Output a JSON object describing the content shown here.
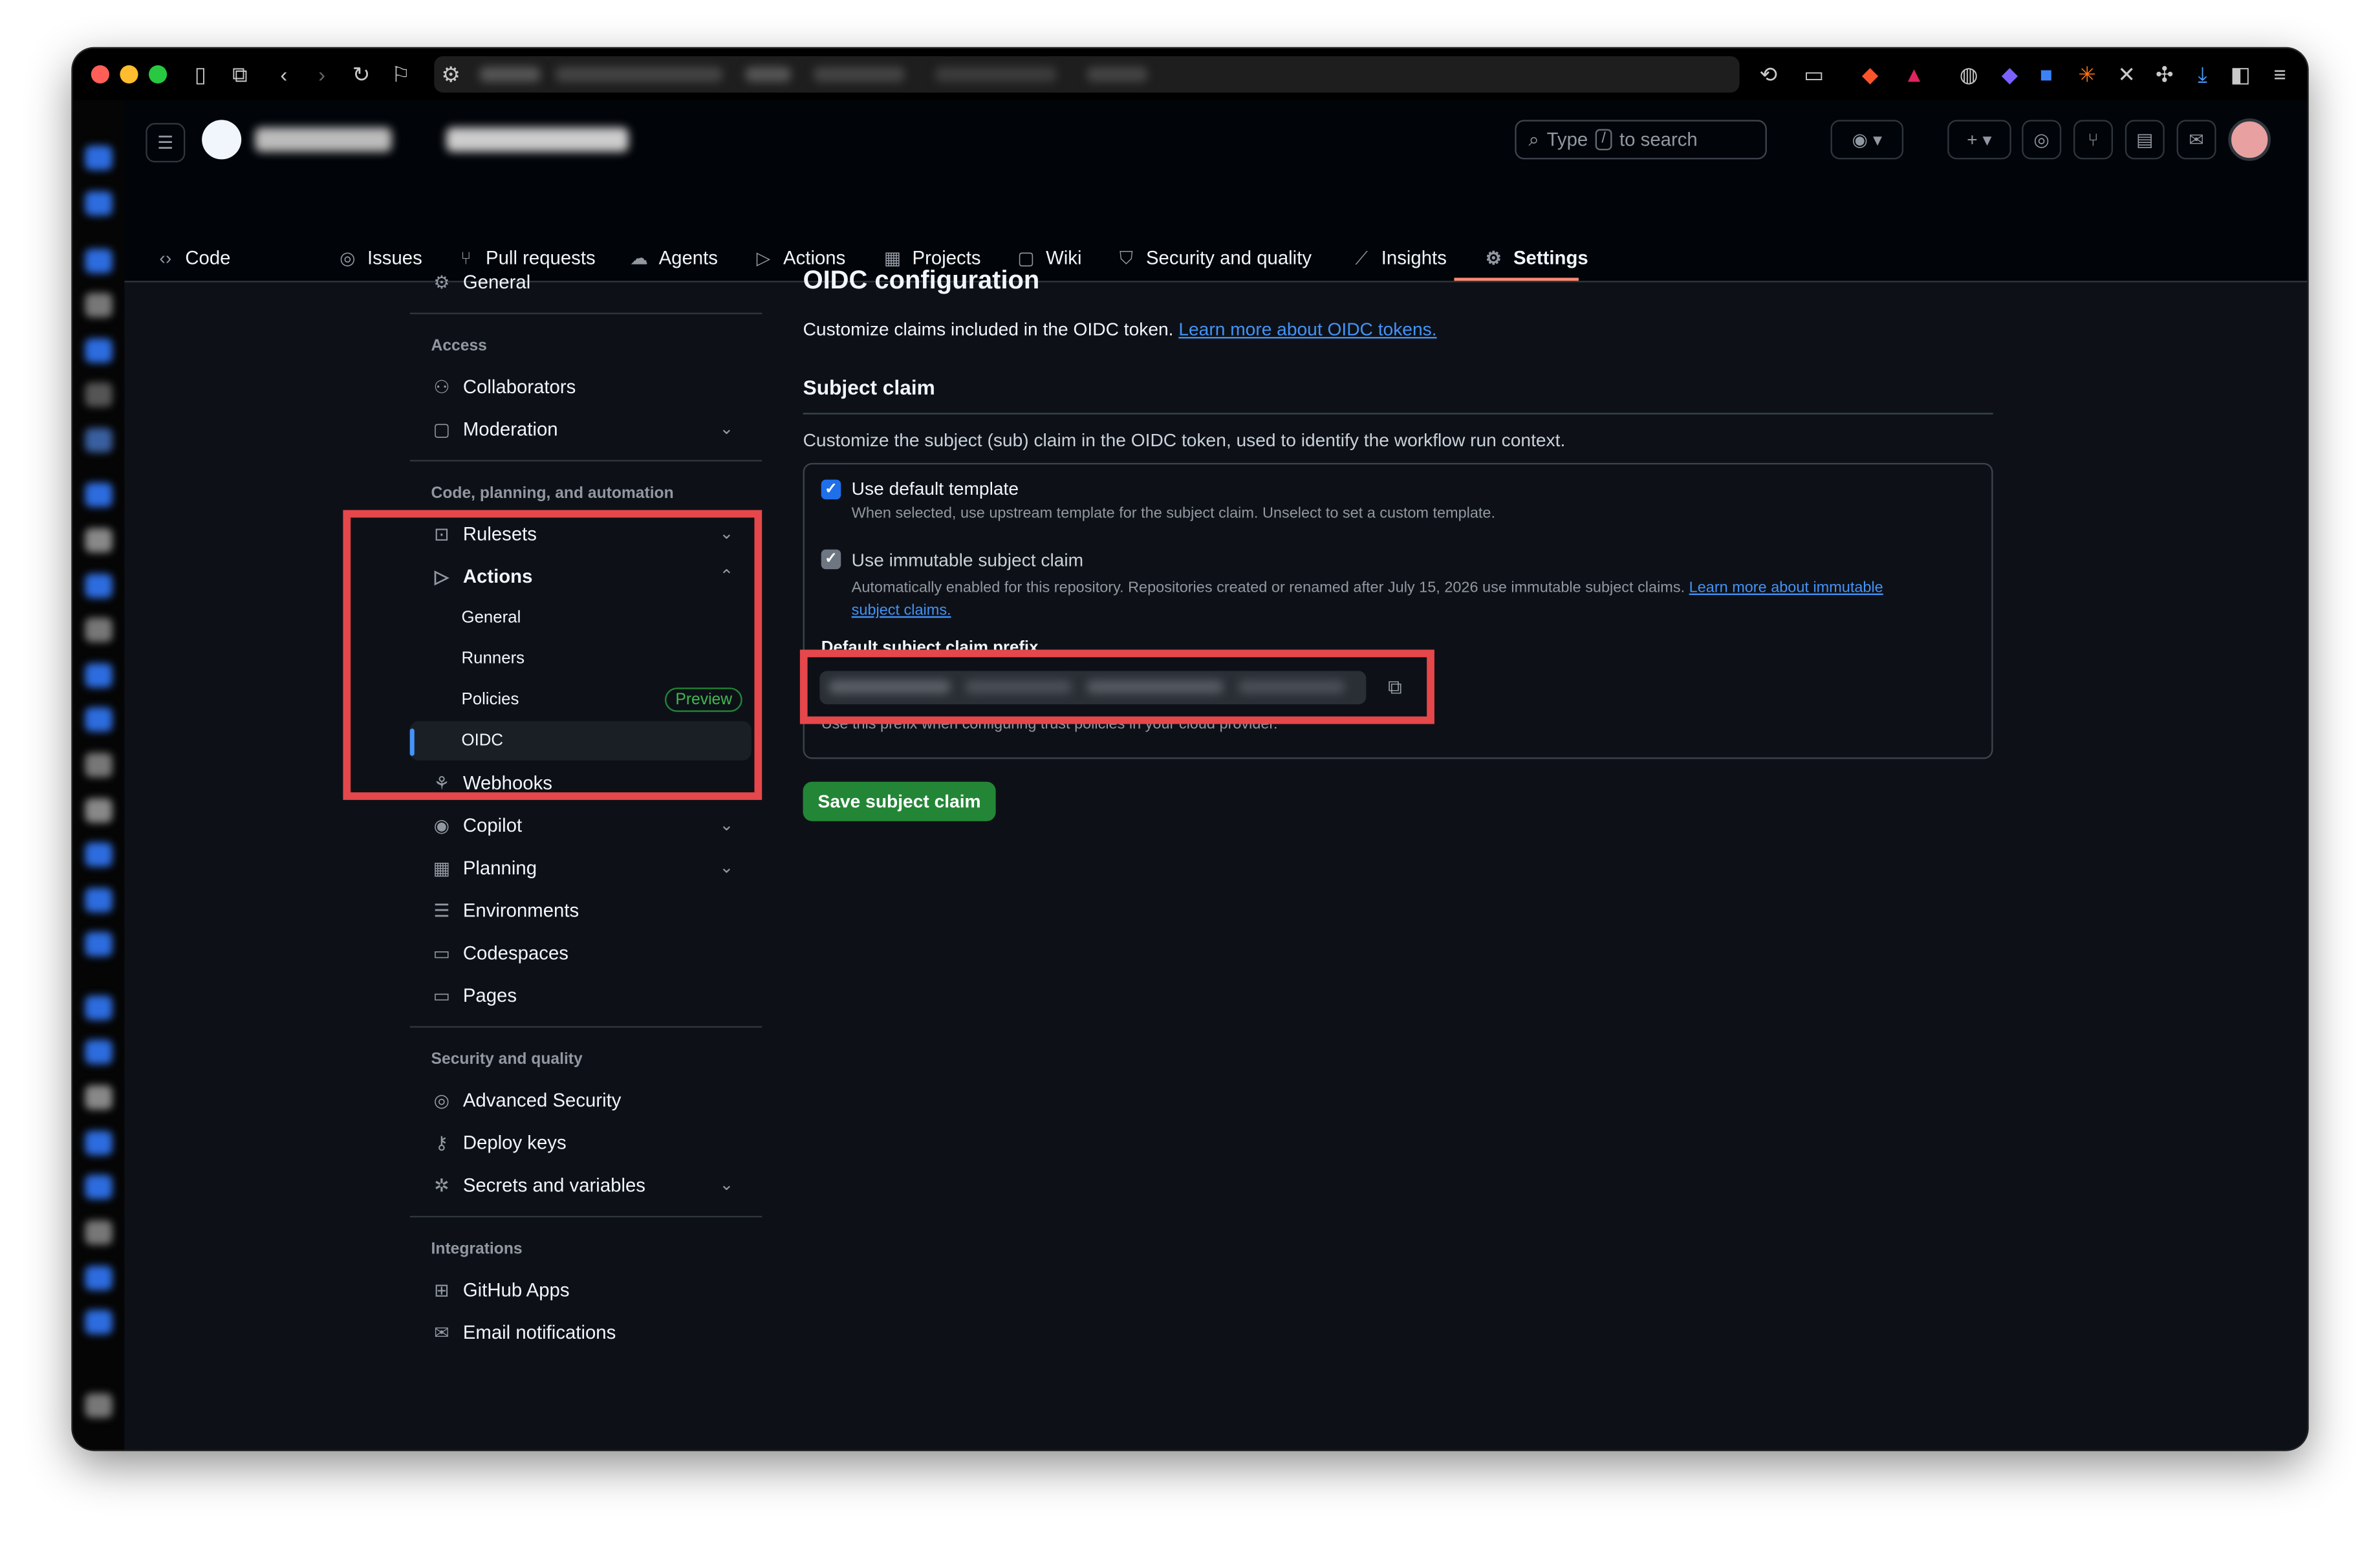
{
  "github": {
    "search": {
      "prefix": "Type",
      "key": "/",
      "suffix": "to search"
    },
    "nav_tabs": [
      {
        "label": "Code",
        "icon": "code-icon"
      },
      {
        "label": "Issues",
        "icon": "issue-icon"
      },
      {
        "label": "Pull requests",
        "icon": "pull-request-icon"
      },
      {
        "label": "Agents",
        "icon": "agent-icon"
      },
      {
        "label": "Actions",
        "icon": "play-icon"
      },
      {
        "label": "Projects",
        "icon": "table-icon"
      },
      {
        "label": "Wiki",
        "icon": "book-icon"
      },
      {
        "label": "Security and quality",
        "icon": "shield-icon"
      },
      {
        "label": "Insights",
        "icon": "graph-icon"
      },
      {
        "label": "Settings",
        "icon": "gear-icon",
        "active": true
      }
    ]
  },
  "sidebar": {
    "general": "General",
    "groups": {
      "access": "Access",
      "code": "Code, planning, and automation",
      "security": "Security and quality",
      "integrations": "Integrations"
    },
    "items": {
      "collaborators": "Collaborators",
      "moderation": "Moderation",
      "rulesets": "Rulesets",
      "actions": "Actions",
      "webhooks": "Webhooks",
      "copilot": "Copilot",
      "planning": "Planning",
      "environments": "Environments",
      "codespaces": "Codespaces",
      "pages": "Pages",
      "advanced_security": "Advanced Security",
      "deploy_keys": "Deploy keys",
      "secrets": "Secrets and variables",
      "github_apps": "GitHub Apps",
      "email": "Email notifications"
    },
    "actions_sub": {
      "general": "General",
      "runners": "Runners",
      "policies": "Policies",
      "policies_badge": "Preview",
      "oidc": "OIDC"
    }
  },
  "main": {
    "title": "OIDC configuration",
    "intro": "Customize claims included in the OIDC token.",
    "intro_link": "Learn more about OIDC tokens.",
    "subject_heading": "Subject claim",
    "subject_desc": "Customize the subject (sub) claim in the OIDC token, used to identify the workflow run context.",
    "default_template": {
      "label": "Use default template",
      "desc": "When selected, use upstream template for the subject claim. Unselect to set a custom template.",
      "checked": true
    },
    "immutable": {
      "label": "Use immutable subject claim",
      "desc": "Automatically enabled for this repository. Repositories created or renamed after July 15, 2026 use immutable subject claims.",
      "link_line1": "Learn more about immutable",
      "link_line2": "subject claims.",
      "checked": true
    },
    "prefix_label": "Default subject claim prefix",
    "prefix_help": "Use this prefix when configuring trust policies in your cloud provider.",
    "save_button": "Save subject claim"
  },
  "colors": {
    "accent_link": "#4493f8",
    "active_tab_underline": "#fd8c73",
    "primary_button": "#238636",
    "annotation_red": "#e5474b"
  }
}
